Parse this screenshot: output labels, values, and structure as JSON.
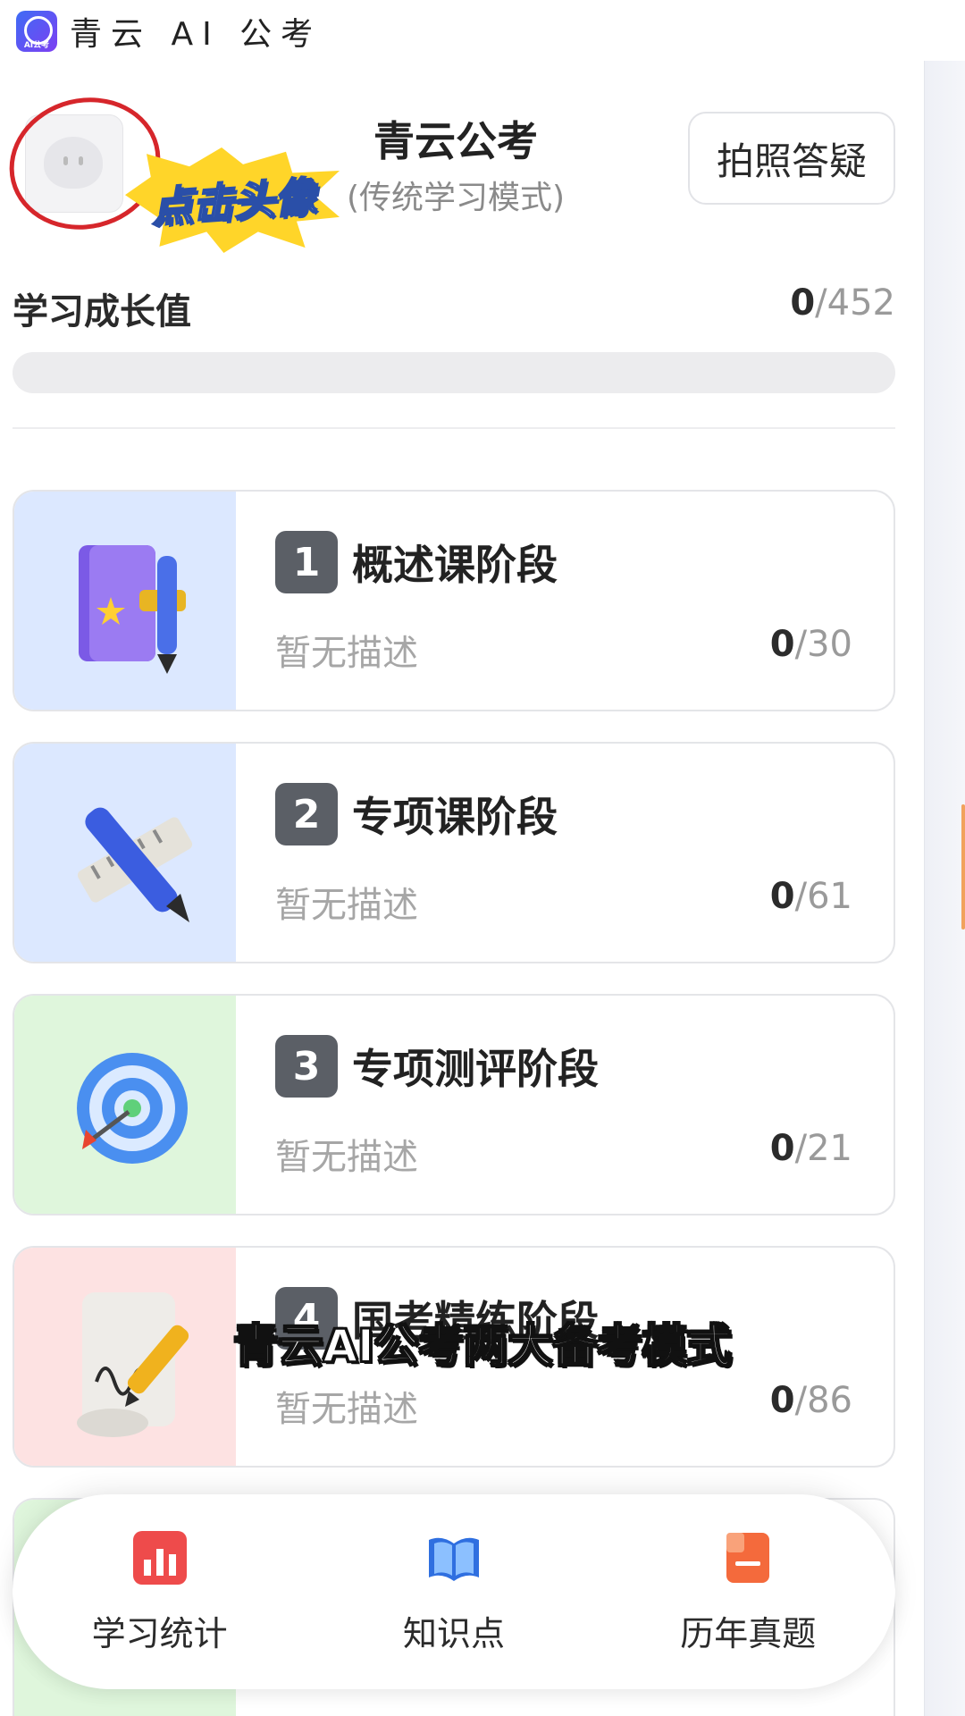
{
  "watermark": {
    "logo_text": "AI公考",
    "text": "青云 AI 公考"
  },
  "header": {
    "avatar_hint": "点击头像",
    "title": "青云公考",
    "subtitle": "(传统学习模式)",
    "photo_button": "拍照答疑"
  },
  "growth": {
    "label": "学习成长值",
    "current": "0",
    "total": "/452",
    "progress_fraction": 0
  },
  "stages": [
    {
      "number": "1",
      "title": "概述课阶段",
      "desc": "暂无描述",
      "current": "0",
      "total": "/30",
      "icon": "book-icon",
      "thumb_color": "#dce8ff"
    },
    {
      "number": "2",
      "title": "专项课阶段",
      "desc": "暂无描述",
      "current": "0",
      "total": "/61",
      "icon": "pen-ruler-icon",
      "thumb_color": "#dce8ff"
    },
    {
      "number": "3",
      "title": "专项测评阶段",
      "desc": "暂无描述",
      "current": "0",
      "total": "/21",
      "icon": "target-icon",
      "thumb_color": "#dff6dc"
    },
    {
      "number": "4",
      "title": "国考精练阶段",
      "desc": "暂无描述",
      "current": "0",
      "total": "/86",
      "icon": "scroll-quill-icon",
      "thumb_color": "#fde2e2"
    }
  ],
  "caption": "青云AI公考两大备考模式",
  "bottom_nav": [
    {
      "label": "学习统计",
      "icon": "bar-chart-icon",
      "color": "#ee4b4b"
    },
    {
      "label": "知识点",
      "icon": "open-book-icon",
      "color": "#2f6fe0"
    },
    {
      "label": "历年真题",
      "icon": "notebook-icon",
      "color": "#f46a3c"
    }
  ]
}
